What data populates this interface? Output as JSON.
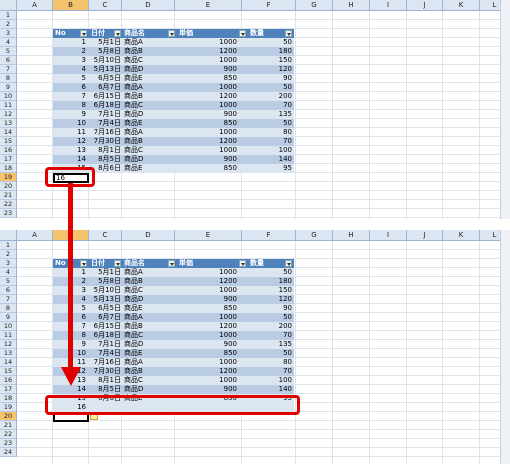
{
  "columns": [
    "A",
    "B",
    "C",
    "D",
    "E",
    "F",
    "G",
    "H",
    "I",
    "J",
    "K",
    "L"
  ],
  "rows_top": [
    "1",
    "2",
    "3",
    "4",
    "5",
    "6",
    "7",
    "8",
    "9",
    "10",
    "11",
    "12",
    "13",
    "14",
    "15",
    "16",
    "17",
    "18",
    "19",
    "20",
    "21",
    "22",
    "23"
  ],
  "rows_bottom": [
    "1",
    "2",
    "3",
    "4",
    "5",
    "6",
    "7",
    "8",
    "9",
    "10",
    "11",
    "12",
    "13",
    "14",
    "15",
    "16",
    "17",
    "18",
    "19",
    "20",
    "21",
    "22",
    "23",
    "24"
  ],
  "table": {
    "headers": [
      "No",
      "日付",
      "商品名",
      "単価",
      "数量"
    ],
    "rows": [
      [
        "1",
        "5月1日",
        "商品A",
        "1000",
        "50"
      ],
      [
        "2",
        "5月8日",
        "商品B",
        "1200",
        "180"
      ],
      [
        "3",
        "5月10日",
        "商品C",
        "1000",
        "150"
      ],
      [
        "4",
        "5月13日",
        "商品D",
        "900",
        "120"
      ],
      [
        "5",
        "6月5日",
        "商品E",
        "850",
        "90"
      ],
      [
        "6",
        "6月7日",
        "商品A",
        "1000",
        "50"
      ],
      [
        "7",
        "6月15日",
        "商品B",
        "1200",
        "200"
      ],
      [
        "8",
        "6月18日",
        "商品C",
        "1000",
        "70"
      ],
      [
        "9",
        "7月1日",
        "商品D",
        "900",
        "135"
      ],
      [
        "10",
        "7月4日",
        "商品E",
        "850",
        "50"
      ],
      [
        "11",
        "7月16日",
        "商品A",
        "1000",
        "80"
      ],
      [
        "12",
        "7月30日",
        "商品B",
        "1200",
        "70"
      ],
      [
        "13",
        "8月1日",
        "商品C",
        "1000",
        "100"
      ],
      [
        "14",
        "8月5日",
        "商品D",
        "900",
        "140"
      ],
      [
        "15",
        "8月6日",
        "商品E",
        "850",
        "95"
      ]
    ]
  },
  "top": {
    "entry_value": "16"
  },
  "bottom": {
    "new_row_no": "16"
  },
  "colors": {
    "highlight": "#e00000",
    "table_header": "#4f81bd"
  }
}
